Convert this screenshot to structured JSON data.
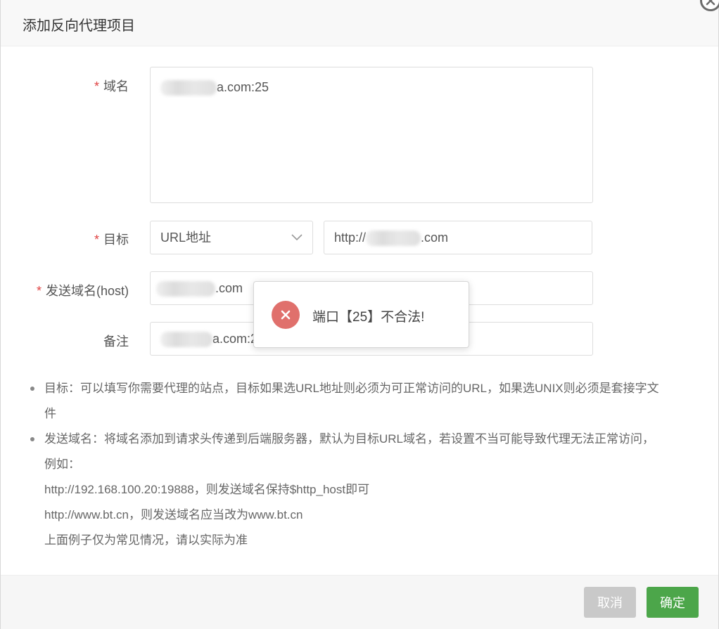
{
  "dialog": {
    "title": "添加反向代理项目"
  },
  "form": {
    "domain": {
      "label": "域名",
      "required_mark": "*",
      "value_suffix": "a.com:25"
    },
    "target": {
      "label": "目标",
      "required_mark": "*",
      "type_selected": "URL地址",
      "url_prefix": "http://",
      "url_suffix": ".com"
    },
    "host": {
      "label": "发送域名(host)",
      "required_mark": "*",
      "value_suffix": ".com"
    },
    "remark": {
      "label": "备注",
      "value_suffix": "a.com:2"
    }
  },
  "notes": [
    {
      "lines": [
        "目标：可以填写你需要代理的站点，目标如果选URL地址则必须为可正常访问的URL，如果选UNIX则必须是套接字文",
        "件"
      ]
    },
    {
      "lines": [
        "发送域名：将域名添加到请求头传递到后端服务器，默认为目标URL域名，若设置不当可能导致代理无法正常访问，",
        "例如：",
        "http://192.168.100.20:19888，则发送域名保持$http_host即可",
        "http://www.bt.cn，则发送域名应当改为www.bt.cn",
        "上面例子仅为常见情况，请以实际为准"
      ]
    }
  ],
  "footer": {
    "cancel_label": "取消",
    "confirm_label": "确定"
  },
  "toast": {
    "message": "端口【25】不合法!",
    "icon": "error-icon"
  },
  "colors": {
    "required": "#e04343",
    "confirm": "#4ca64a",
    "cancel": "#c9c9c9",
    "error": "#e0706c"
  }
}
